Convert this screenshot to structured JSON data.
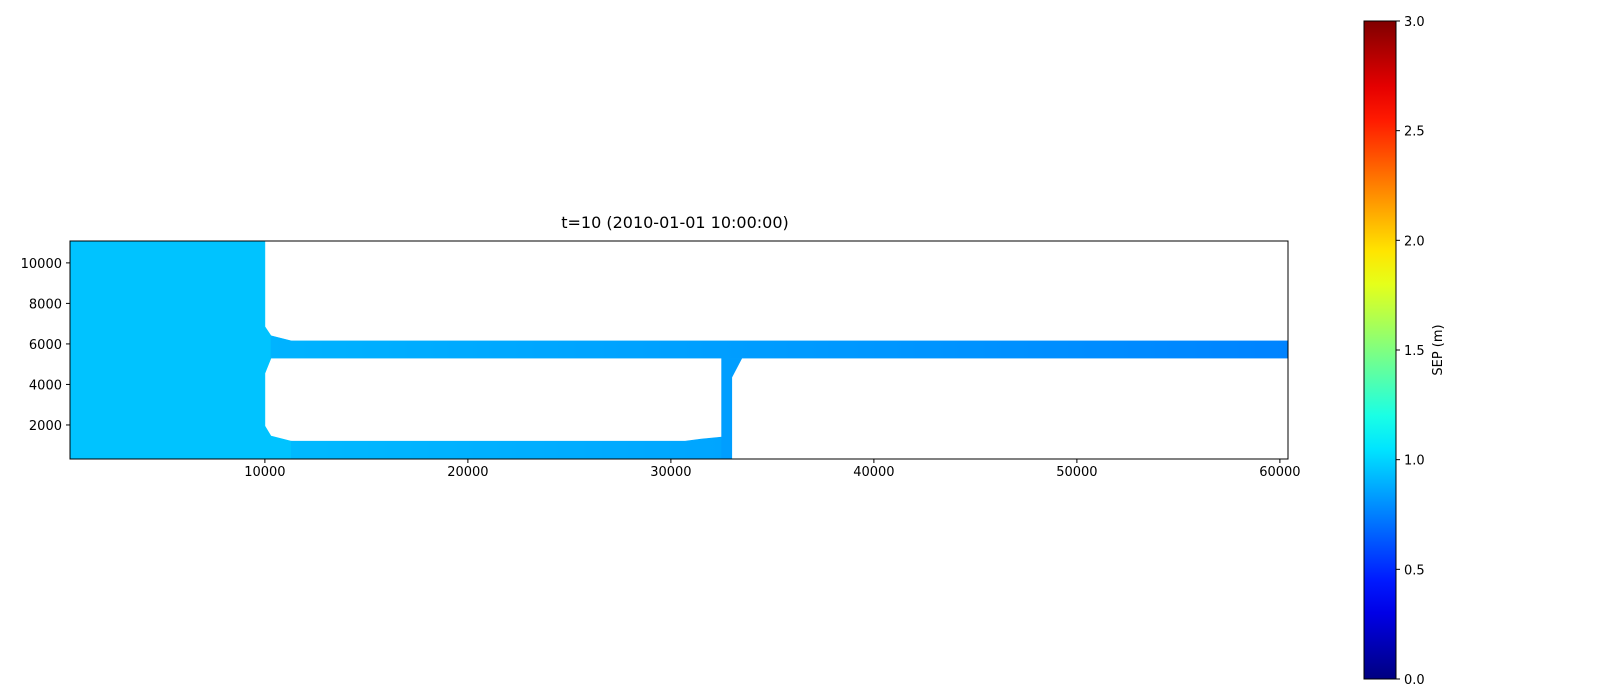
{
  "chart_data": {
    "type": "heatmap",
    "title": "t=10 (2010-01-01 10:00:00)",
    "xlabel": "",
    "ylabel": "",
    "xlim": [
      400,
      60400
    ],
    "ylim": [
      320,
      11080
    ],
    "x_ticks": [
      {
        "value": 10000,
        "label": "10000"
      },
      {
        "value": 20000,
        "label": "20000"
      },
      {
        "value": 30000,
        "label": "30000"
      },
      {
        "value": 40000,
        "label": "40000"
      },
      {
        "value": 50000,
        "label": "50000"
      },
      {
        "value": 60000,
        "label": "60000"
      }
    ],
    "y_ticks": [
      {
        "value": 2000,
        "label": "2000"
      },
      {
        "value": 4000,
        "label": "4000"
      },
      {
        "value": 6000,
        "label": "6000"
      },
      {
        "value": 8000,
        "label": "8000"
      },
      {
        "value": 10000,
        "label": "10000"
      }
    ],
    "grid": false,
    "colormap": "jet",
    "regions": [
      {
        "name": "basin",
        "value": 0.95,
        "polygon": [
          [
            400,
            320
          ],
          [
            400,
            11080
          ],
          [
            10000,
            11080
          ],
          [
            10000,
            6850
          ],
          [
            10300,
            6400
          ],
          [
            10300,
            5300
          ],
          [
            10000,
            4550
          ],
          [
            10000,
            1950
          ],
          [
            10300,
            1450
          ],
          [
            11300,
            1200
          ],
          [
            11300,
            320
          ]
        ]
      },
      {
        "name": "upper-channel",
        "value": 0.82,
        "gradient": {
          "x_start": 10300,
          "x_end": 60400,
          "value_start": 0.9,
          "value_end": 0.76
        },
        "polygon": [
          [
            10300,
            6400
          ],
          [
            11300,
            6150
          ],
          [
            60400,
            6150
          ],
          [
            60400,
            5300
          ],
          [
            10300,
            5300
          ]
        ]
      },
      {
        "name": "lower-channel",
        "value": 0.88,
        "gradient": {
          "x_start": 11300,
          "x_end": 32500,
          "value_start": 0.92,
          "value_end": 0.86
        },
        "polygon": [
          [
            11300,
            1200
          ],
          [
            30700,
            1200
          ],
          [
            31500,
            1300
          ],
          [
            32500,
            1400
          ],
          [
            32500,
            320
          ],
          [
            11300,
            320
          ]
        ]
      },
      {
        "name": "connector",
        "value": 0.84,
        "polygon": [
          [
            32500,
            320
          ],
          [
            33000,
            320
          ],
          [
            33000,
            4350
          ],
          [
            33500,
            5300
          ],
          [
            32500,
            5300
          ]
        ]
      }
    ],
    "colorbar": {
      "label": "SEP (m)",
      "min": 0.0,
      "max": 3.0,
      "ticks": [
        {
          "value": 0.0,
          "label": "0.0"
        },
        {
          "value": 0.5,
          "label": "0.5"
        },
        {
          "value": 1.0,
          "label": "1.0"
        },
        {
          "value": 1.5,
          "label": "1.5"
        },
        {
          "value": 2.0,
          "label": "2.0"
        },
        {
          "value": 2.5,
          "label": "2.5"
        },
        {
          "value": 3.0,
          "label": "3.0"
        }
      ]
    }
  }
}
